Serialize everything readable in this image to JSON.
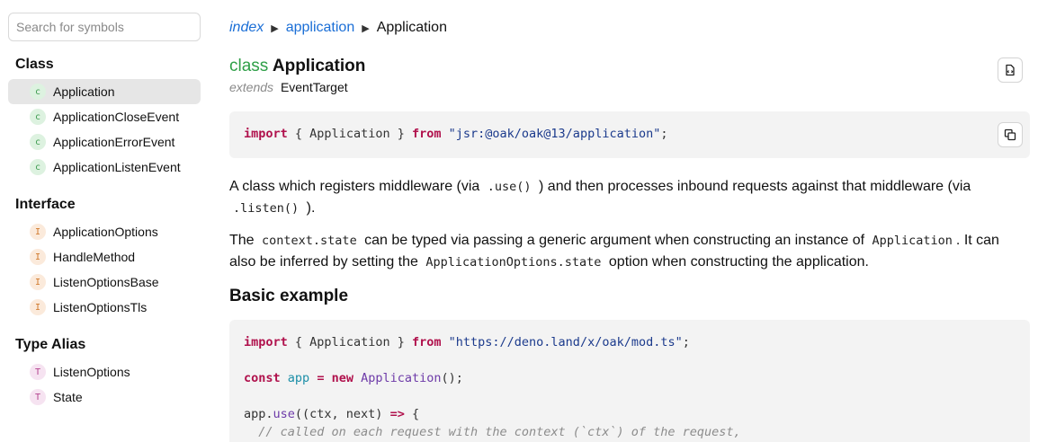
{
  "sidebar": {
    "search_placeholder": "Search for symbols",
    "groups": [
      {
        "title": "Class",
        "items": [
          {
            "badge": "c",
            "label": "Application",
            "active": true
          },
          {
            "badge": "c",
            "label": "ApplicationCloseEvent"
          },
          {
            "badge": "c",
            "label": "ApplicationErrorEvent"
          },
          {
            "badge": "c",
            "label": "ApplicationListenEvent"
          }
        ]
      },
      {
        "title": "Interface",
        "items": [
          {
            "badge": "I",
            "label": "ApplicationOptions"
          },
          {
            "badge": "I",
            "label": "HandleMethod"
          },
          {
            "badge": "I",
            "label": "ListenOptionsBase"
          },
          {
            "badge": "I",
            "label": "ListenOptionsTls"
          }
        ]
      },
      {
        "title": "Type Alias",
        "items": [
          {
            "badge": "T",
            "label": "ListenOptions"
          },
          {
            "badge": "T",
            "label": "State"
          }
        ]
      }
    ]
  },
  "breadcrumb": {
    "root": "index",
    "module": "application",
    "current": "Application",
    "separator": "▶"
  },
  "header": {
    "keyword": "class",
    "name": "Application",
    "extends_keyword": "extends",
    "extends_name": "EventTarget"
  },
  "import_code": {
    "kw_import": "import",
    "braces": "{ Application }",
    "kw_from": "from",
    "path": "\"jsr:@oak/oak@13/application\"",
    "end": ";"
  },
  "description": {
    "p1_a": "A class which registers middleware (via",
    "p1_code1": ".use()",
    "p1_b": ") and then processes inbound requests against that middleware (via",
    "p1_code2": ".listen()",
    "p1_c": ").",
    "p2_a": "The",
    "p2_code1": "context.state",
    "p2_b": "can be typed via passing a generic argument when constructing an instance of",
    "p2_code2": "Application",
    "p2_c": ". It can also be inferred by setting the",
    "p2_code3": "ApplicationOptions.state",
    "p2_d": "option when constructing the application."
  },
  "example": {
    "heading": "Basic example",
    "l1_import": "import",
    "l1_braces": "{ Application }",
    "l1_from": "from",
    "l1_path": "\"https://deno.land/x/oak/mod.ts\"",
    "l1_end": ";",
    "l2_const": "const",
    "l2_var": "app",
    "l2_eq": "=",
    "l2_new": "new",
    "l2_cls": "Application",
    "l2_end": "();",
    "l3_app": "app.",
    "l3_use": "use",
    "l3_args": "((ctx, next)",
    "l3_arrow": "=>",
    "l3_brace": "{",
    "l4_comment": "  // called on each request with the context (`ctx`) of the request,"
  },
  "colors": {
    "link": "#1a6ed6",
    "class_keyword": "#2e9f47",
    "code_keyword": "#b0114c",
    "code_string": "#1b3a8c",
    "code_bg": "#f3f3f3",
    "active_item_bg": "#e6e6e6"
  },
  "icons": {
    "source_button": "source-file-icon",
    "copy_button": "copy-icon"
  }
}
